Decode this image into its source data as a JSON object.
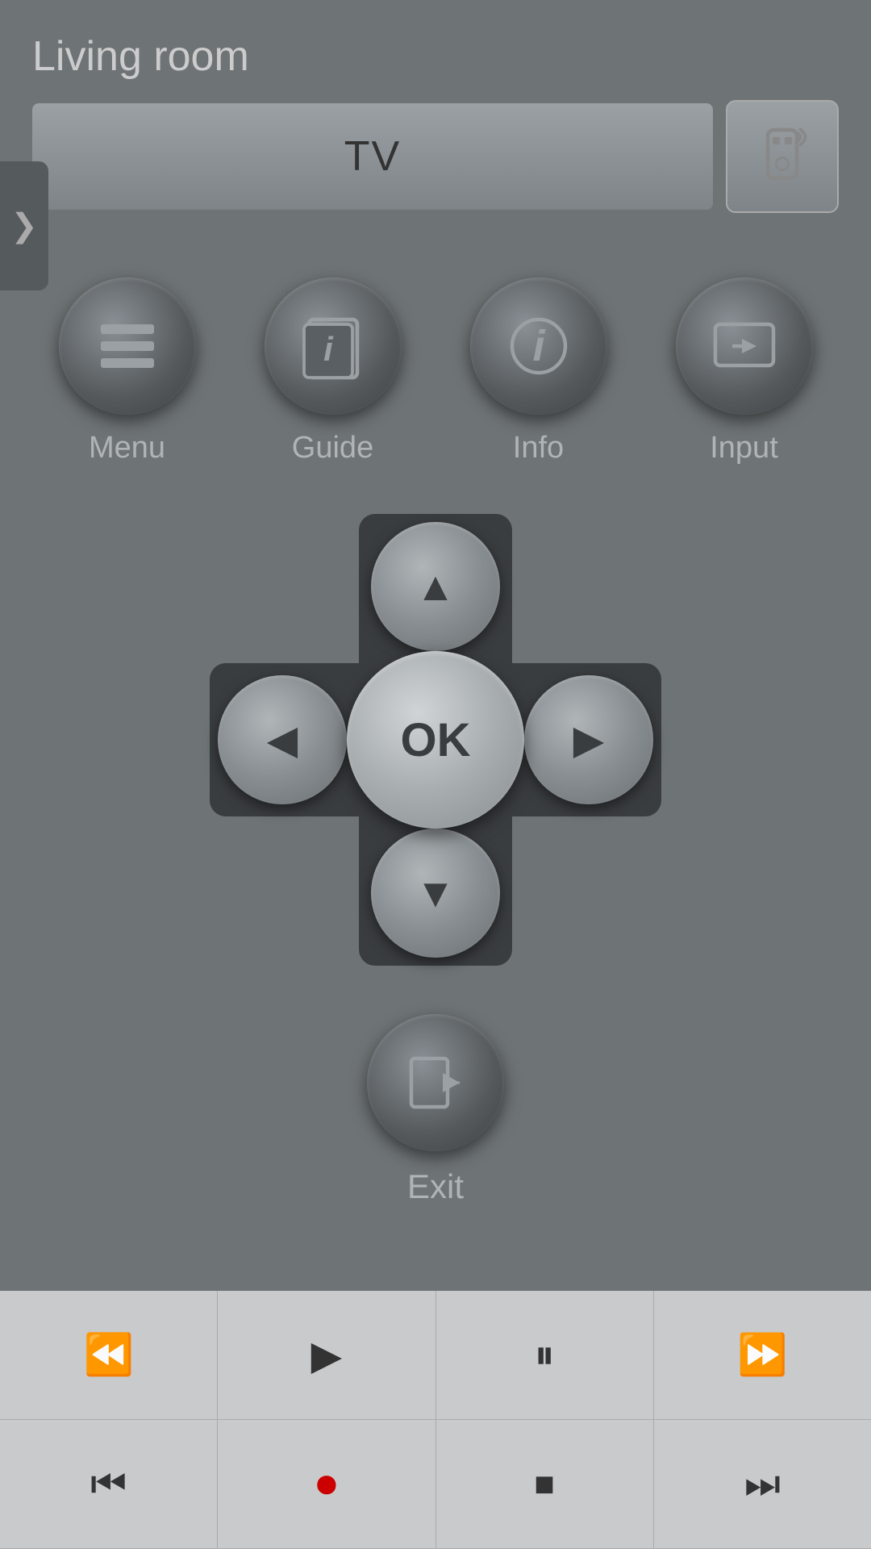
{
  "header": {
    "room_label": "Living room",
    "device_name": "TV",
    "remote_icon_label": "remote-icon"
  },
  "function_buttons": [
    {
      "id": "menu",
      "label": "Menu",
      "icon": "menu-icon"
    },
    {
      "id": "guide",
      "label": "Guide",
      "icon": "guide-icon"
    },
    {
      "id": "info",
      "label": "Info",
      "icon": "info-icon"
    },
    {
      "id": "input",
      "label": "Input",
      "icon": "input-icon"
    }
  ],
  "dpad": {
    "ok_label": "OK",
    "up_label": "up",
    "down_label": "down",
    "left_label": "left",
    "right_label": "right"
  },
  "exit": {
    "label": "Exit"
  },
  "side_tab": {
    "chevron": "❯"
  },
  "transport": {
    "row1": [
      {
        "id": "rewind",
        "icon": "⏪"
      },
      {
        "id": "play",
        "icon": "▶"
      },
      {
        "id": "pause",
        "icon": "⏸"
      },
      {
        "id": "fast-forward",
        "icon": "⏩"
      }
    ],
    "row2": [
      {
        "id": "skip-back",
        "icon": "⏮"
      },
      {
        "id": "record",
        "icon": "⏺",
        "color": "red"
      },
      {
        "id": "stop",
        "icon": "⏹"
      },
      {
        "id": "skip-forward",
        "icon": "⏭"
      }
    ]
  }
}
